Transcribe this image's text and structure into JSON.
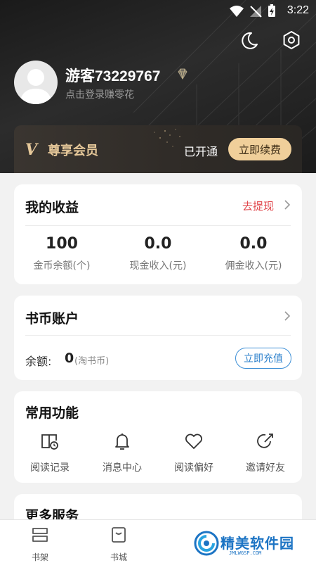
{
  "status_bar": {
    "time": "3:22"
  },
  "profile": {
    "username": "游客73229767",
    "login_hint": "点击登录赚零花"
  },
  "vip": {
    "logo": "V",
    "title": "尊享会员",
    "status": "已开通",
    "renew_label": "立即续费"
  },
  "earnings": {
    "title": "我的收益",
    "action": "去提现",
    "items": [
      {
        "value": "100",
        "label": "金币余额(个)"
      },
      {
        "value": "0.0",
        "label": "现金收入(元)"
      },
      {
        "value": "0.0",
        "label": "佣金收入(元)"
      }
    ]
  },
  "book_coins": {
    "title": "书币账户",
    "balance_label": "余额:",
    "balance_value": "0",
    "balance_unit": "(淘书币)",
    "recharge_label": "立即充值"
  },
  "functions": {
    "title": "常用功能",
    "items": [
      {
        "label": "阅读记录",
        "icon": "reading-history-icon"
      },
      {
        "label": "消息中心",
        "icon": "bell-icon"
      },
      {
        "label": "阅读偏好",
        "icon": "heart-icon"
      },
      {
        "label": "邀请好友",
        "icon": "share-icon"
      }
    ]
  },
  "more_services": {
    "title": "更多服务"
  },
  "bottom_nav": {
    "items": [
      {
        "label": "书架",
        "icon": "bookshelf-icon"
      },
      {
        "label": "书城",
        "icon": "bookstore-icon"
      }
    ]
  },
  "watermark": {
    "text": "精美软件园",
    "url": "JMLWGSP.COM"
  },
  "colors": {
    "header_bg": "#1f1f1f",
    "vip_gold": "#e7c99a",
    "renew_button": "#f0cf9a",
    "withdraw_red": "#e0474c",
    "recharge_blue": "#2a7fcb"
  }
}
